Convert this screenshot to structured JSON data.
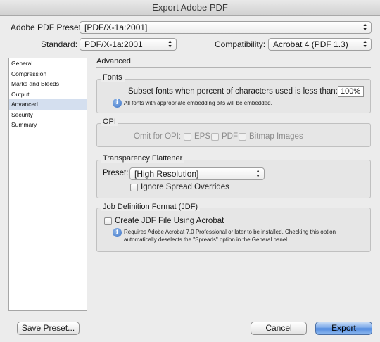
{
  "window": {
    "title": "Export Adobe PDF"
  },
  "preset": {
    "label": "Adobe PDF Preset:",
    "value": "[PDF/X-1a:2001]"
  },
  "standard": {
    "label": "Standard:",
    "value": "PDF/X-1a:2001"
  },
  "compatibility": {
    "label": "Compatibility:",
    "value": "Acrobat 4 (PDF 1.3)"
  },
  "sidebar": {
    "items": [
      {
        "label": "General"
      },
      {
        "label": "Compression"
      },
      {
        "label": "Marks and Bleeds"
      },
      {
        "label": "Output"
      },
      {
        "label": "Advanced",
        "selected": true
      },
      {
        "label": "Security"
      },
      {
        "label": "Summary"
      }
    ]
  },
  "section": {
    "title": "Advanced"
  },
  "fonts": {
    "title": "Fonts",
    "subset_label": "Subset fonts when percent of characters used is less than:",
    "subset_value": "100%",
    "info": "All fonts with appropriate embedding bits will be embedded."
  },
  "opi": {
    "title": "OPI",
    "omit_label": "Omit for OPI:",
    "eps": "EPS",
    "pdf": "PDF",
    "bitmap": "Bitmap Images"
  },
  "transparency": {
    "title": "Transparency Flattener",
    "preset_label": "Preset:",
    "preset_value": "[High Resolution]",
    "ignore_label": "Ignore Spread Overrides"
  },
  "jdf": {
    "title": "Job Definition Format (JDF)",
    "create_label": "Create JDF File Using Acrobat",
    "info_line1": "Requires Adobe Acrobat 7.0 Professional or later to be installed. Checking this option",
    "info_line2": "automatically deselects the \"Spreads\" option in the General panel."
  },
  "buttons": {
    "save_preset": "Save Preset...",
    "cancel": "Cancel",
    "export": "Export"
  },
  "colors": {
    "sidebar_selection": "#d4dfef",
    "default_button": "#5b93e2"
  }
}
